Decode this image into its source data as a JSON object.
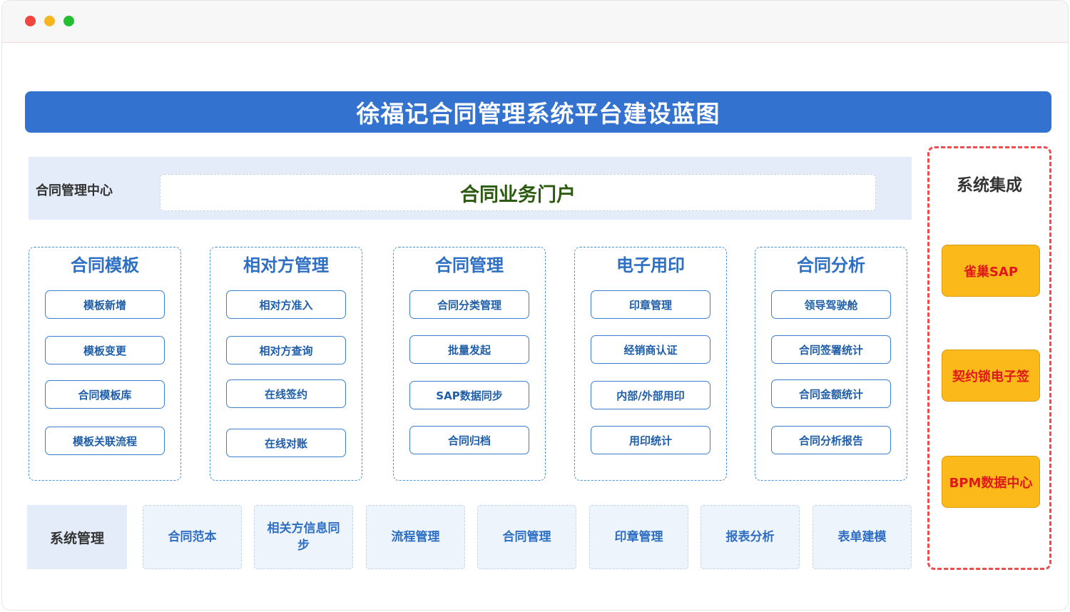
{
  "window": {
    "controls": [
      "close",
      "minimize",
      "maximize"
    ]
  },
  "banner": {
    "title": "徐福记合同管理系统平台建设蓝图"
  },
  "center": {
    "label": "合同管理中心",
    "portal": "合同业务门户"
  },
  "modules": [
    {
      "title": "合同模板",
      "items": [
        "模板新增",
        "模板变更",
        "合同模板库",
        "模板关联流程"
      ]
    },
    {
      "title": "相对方管理",
      "items": [
        "相对方准入",
        "相对方查询",
        "在线签约",
        "在线对账"
      ]
    },
    {
      "title": "合同管理",
      "items": [
        "合同分类管理",
        "批量发起",
        "SAP数据同步",
        "合同归档"
      ]
    },
    {
      "title": "电子用印",
      "items": [
        "印章管理",
        "经销商认证",
        "内部/外部用印",
        "用印统计"
      ]
    },
    {
      "title": "合同分析",
      "items": [
        "领导驾驶舱",
        "合同签署统计",
        "合同金额统计",
        "合同分析报告"
      ]
    }
  ],
  "system_management": {
    "label": "系统管理",
    "items": [
      "合同范本",
      "相关方信息同步",
      "流程管理",
      "合同管理",
      "印章管理",
      "报表分析",
      "表单建模"
    ]
  },
  "integration": {
    "title": "系统集成",
    "items": [
      "雀巢SAP",
      "契约锁电子签",
      "BPM数据中心"
    ]
  },
  "colors": {
    "banner": "#3372cf",
    "module_border": "#4b91db",
    "integration_border": "#ee4d4d",
    "integration_fill": "#fbb91a",
    "portal_text": "#2c5a10"
  }
}
